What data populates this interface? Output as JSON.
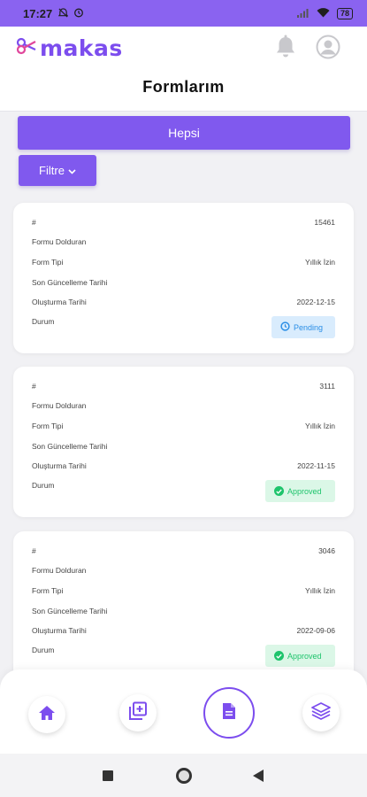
{
  "status_bar": {
    "time": "17:27",
    "battery": "78"
  },
  "header": {
    "logo_text": "makas",
    "title": "Formlarım"
  },
  "tabs": {
    "all_label": "Hepsi"
  },
  "filter": {
    "label": "Filtre"
  },
  "field_labels": {
    "id": "#",
    "filled_by": "Formu Dolduran",
    "form_type": "Form Tipi",
    "last_update": "Son Güncelleme Tarihi",
    "created": "Oluşturma Tarihi",
    "status": "Durum"
  },
  "forms": [
    {
      "id": "15461",
      "filled_by": "",
      "form_type": "Yıllık İzin",
      "last_update": "",
      "created": "2022-12-15",
      "status": "Pending"
    },
    {
      "id": "3111",
      "filled_by": "",
      "form_type": "Yıllık İzin",
      "last_update": "",
      "created": "2022-11-15",
      "status": "Approved"
    },
    {
      "id": "3046",
      "filled_by": "",
      "form_type": "Yıllık İzin",
      "last_update": "",
      "created": "2022-09-06",
      "status": "Approved"
    }
  ],
  "colors": {
    "primary": "#8059ee",
    "pending": "#2a8ee6",
    "approved": "#1ec46c"
  },
  "bottom_nav": {
    "icons": [
      "home-icon",
      "add-form-icon",
      "document-icon",
      "layers-icon"
    ]
  }
}
